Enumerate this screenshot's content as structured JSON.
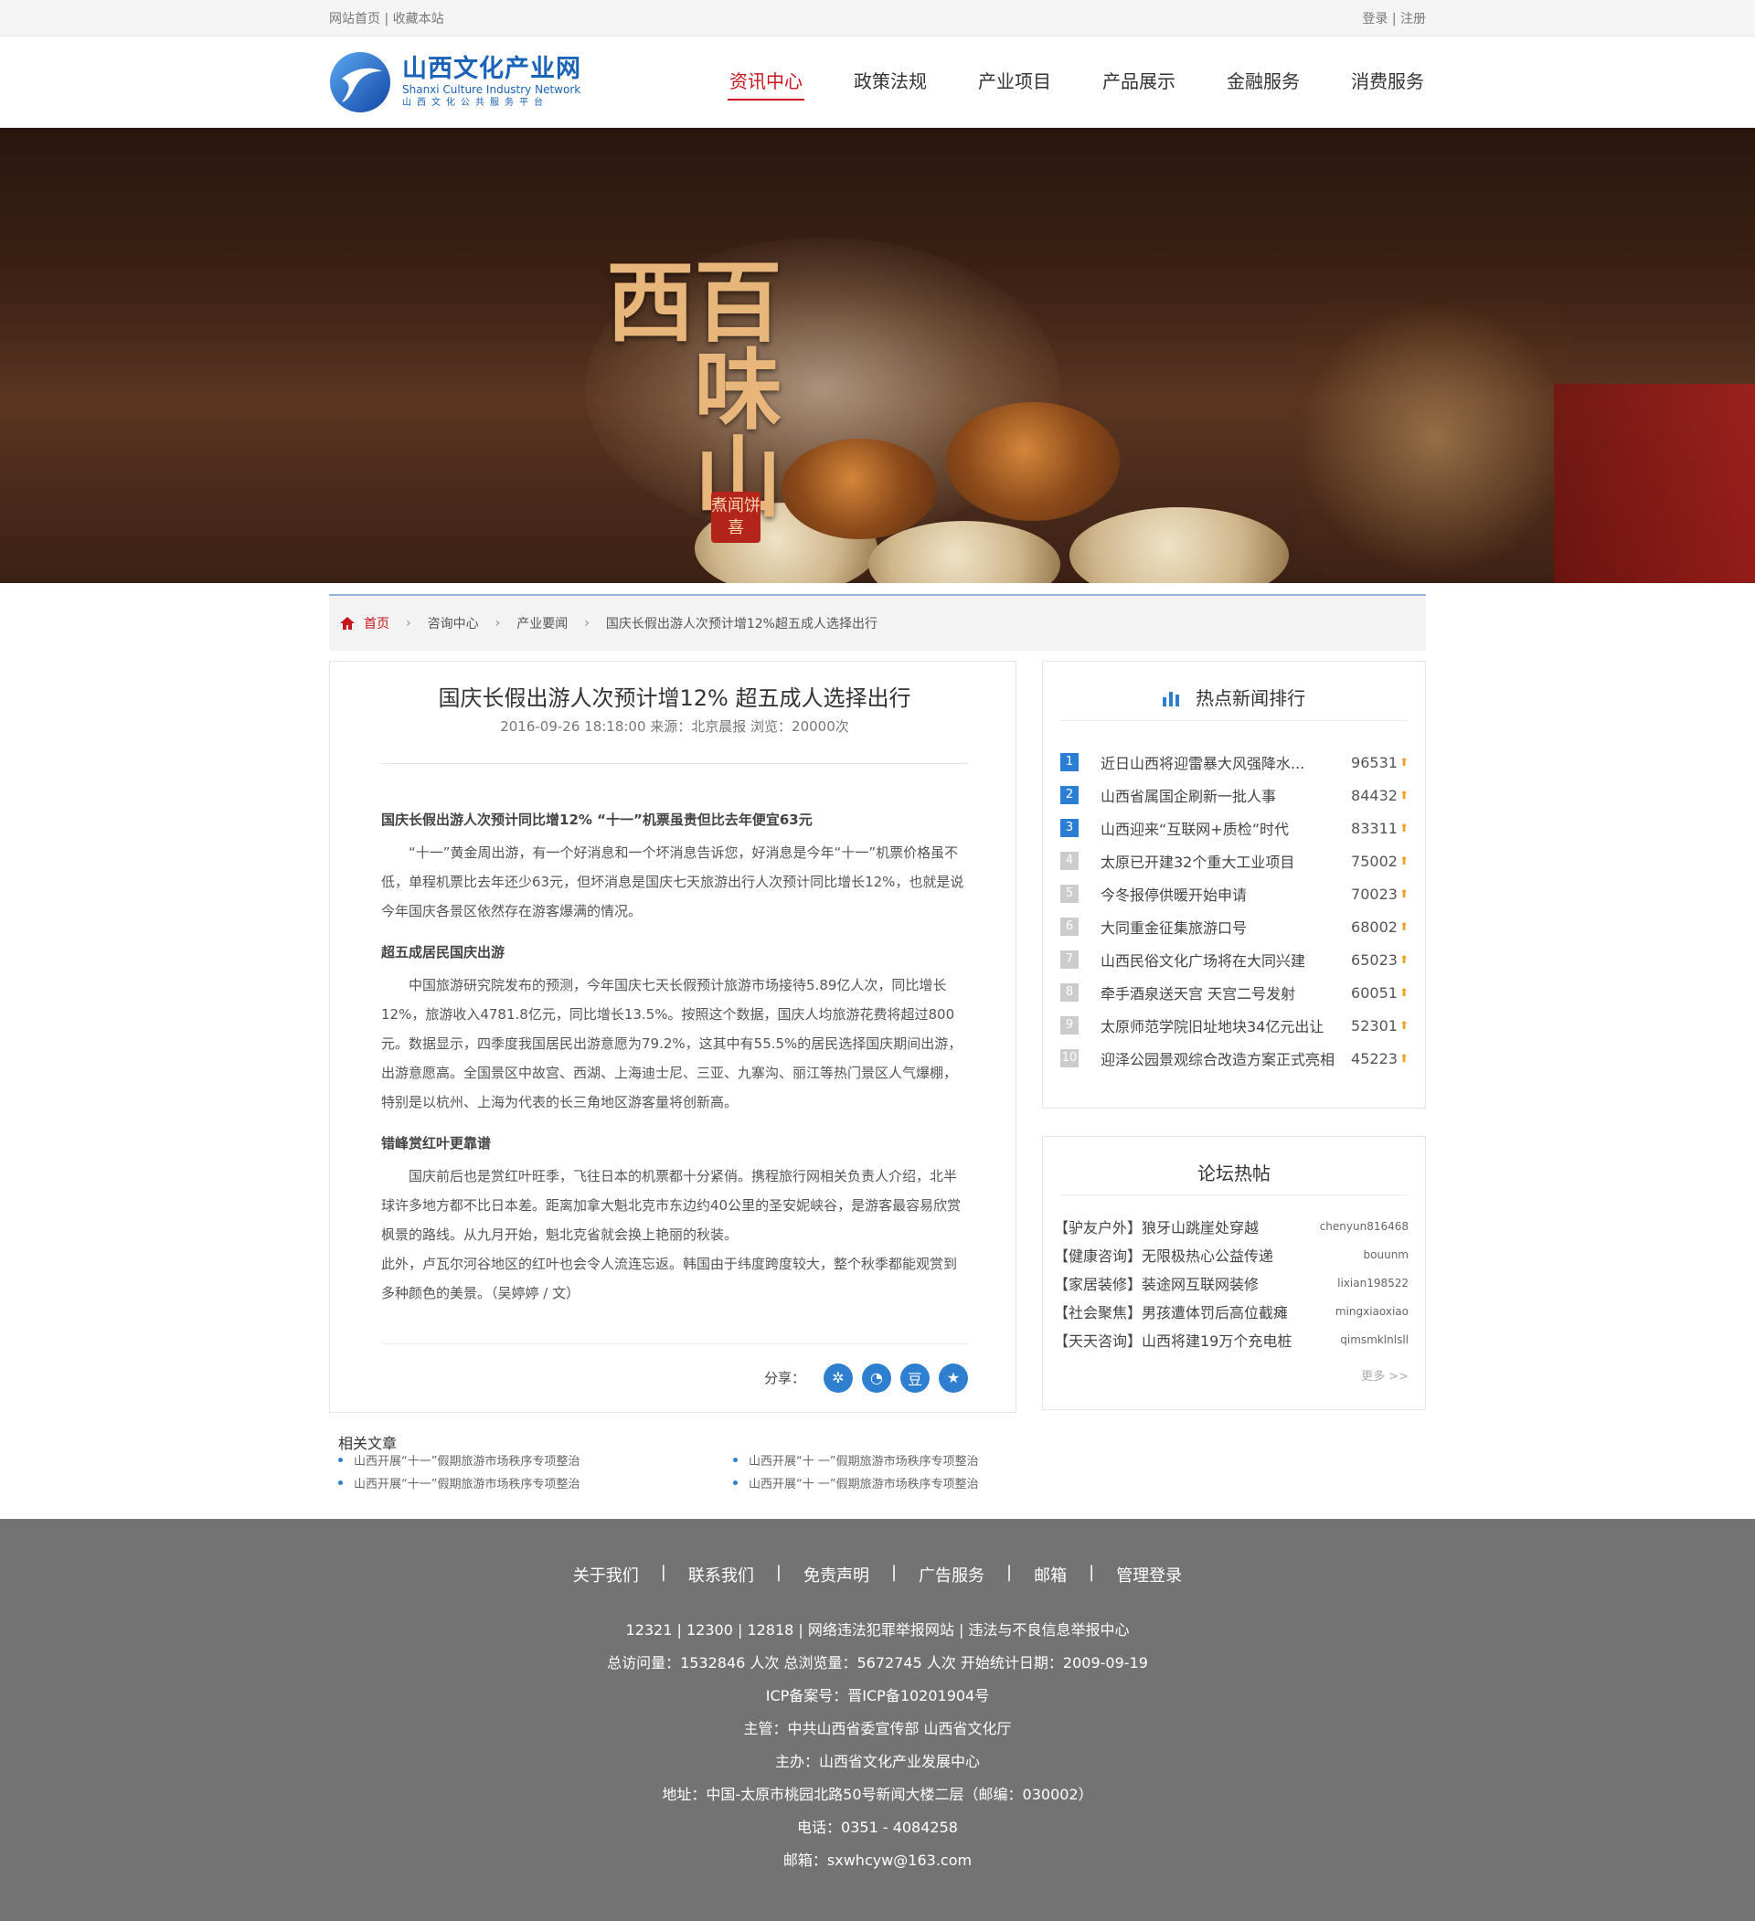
{
  "topbar": {
    "left": "网站首页 | 收藏本站",
    "right": "登录 | 注册"
  },
  "logo": {
    "cn": "山西文化产业网",
    "en": "Shanxi Culture Industry Network",
    "sub": "山西文化公共服务平台"
  },
  "nav": [
    "资讯中心",
    "政策法规",
    "产业项目",
    "产品展示",
    "金融服务",
    "消费服务"
  ],
  "banner": {
    "title": "百味山西",
    "seal": "煮闻饼喜"
  },
  "breadcrumb": [
    "首页",
    "咨询中心",
    "产业要闻",
    "国庆长假出游人次预计增12%超五成人选择出行"
  ],
  "article": {
    "title": "国庆长假出游人次预计增12% 超五成人选择出行",
    "meta": "2016-09-26 18:18:00 来源：北京晨报   浏览：20000次",
    "sections": [
      {
        "heading": "国庆长假出游人次预计同比增12%  “十一”机票虽贵但比去年便宜63元",
        "paras": [
          "“十一”黄金周出游，有一个好消息和一个坏消息告诉您，好消息是今年“十一”机票价格虽不低，单程机票比去年还少63元，但坏消息是国庆七天旅游出行人次预计同比增长12%，也就是说今年国庆各景区依然存在游客爆满的情况。"
        ]
      },
      {
        "heading": "超五成居民国庆出游",
        "paras": [
          "中国旅游研究院发布的预测，今年国庆七天长假预计旅游市场接待5.89亿人次，同比增长12%，旅游收入4781.8亿元，同比增长13.5%。按照这个数据，国庆人均旅游花费将超过800元。数据显示，四季度我国居民出游意愿为79.2%，这其中有55.5%的居民选择国庆期间出游，出游意愿高。全国景区中故宫、西湖、上海迪士尼、三亚、九寨沟、丽江等热门景区人气爆棚，特别是以杭州、上海为代表的长三角地区游客量将创新高。"
        ]
      },
      {
        "heading": "错峰赏红叶更靠谱",
        "paras": [
          "国庆前后也是赏红叶旺季，飞往日本的机票都十分紧俏。携程旅行网相关负责人介绍，北半球许多地方都不比日本差。距离加拿大魁北克市东边约40公里的圣安妮峡谷，是游客最容易欣赏枫景的路线。从九月开始，魁北克省就会换上艳丽的秋装。",
          "此外，卢瓦尔河谷地区的红叶也会令人流连忘返。韩国由于纬度跨度较大，整个秋季都能观赏到多种颜色的美景。（吴婷婷 / 文）"
        ]
      }
    ],
    "share_label": "分享：",
    "share_icons": [
      "weibo-icon",
      "wechat-icon",
      "douban-icon",
      "qzone-icon"
    ]
  },
  "hot": {
    "title": "热点新闻排行",
    "items": [
      {
        "rank": "1",
        "title": "近日山西将迎雷暴大风强降水...",
        "count": "96531"
      },
      {
        "rank": "2",
        "title": "山西省属国企刷新一批人事",
        "count": "84432"
      },
      {
        "rank": "3",
        "title": "山西迎来“互联网+质检”时代",
        "count": "83311"
      },
      {
        "rank": "4",
        "title": "太原已开建32个重大工业项目",
        "count": "75002"
      },
      {
        "rank": "5",
        "title": "今冬报停供暖开始申请",
        "count": "70023"
      },
      {
        "rank": "6",
        "title": "大同重金征集旅游口号",
        "count": "68002"
      },
      {
        "rank": "7",
        "title": "山西民俗文化广场将在大同兴建",
        "count": "65023"
      },
      {
        "rank": "8",
        "title": "牵手酒泉送天宫 天宫二号发射",
        "count": "60051"
      },
      {
        "rank": "9",
        "title": "太原师范学院旧址地块34亿元出让",
        "count": "52301"
      },
      {
        "rank": "10",
        "title": "迎泽公园景观综合改造方案正式亮相",
        "count": "45223"
      }
    ]
  },
  "forum": {
    "title": "论坛热帖",
    "items": [
      {
        "title": "【驴友户外】狼牙山跳崖处穿越",
        "user": "chenyun816468"
      },
      {
        "title": "【健康咨询】无限极热心公益传递",
        "user": "bouunm"
      },
      {
        "title": "【家居装修】装途网互联网装修",
        "user": "lixian198522"
      },
      {
        "title": "【社会聚焦】男孩遭体罚后高位截瘫",
        "user": "mingxiaoxiao"
      },
      {
        "title": "【天天咨询】山西将建19万个充电桩",
        "user": "qimsmklnlsll"
      }
    ],
    "more": "更多 >>"
  },
  "related": {
    "title": "相关文章",
    "items": [
      "山西开展“十一”假期旅游市场秩序专项整治",
      "山西开展“十 一”假期旅游市场秩序专项整治",
      "山西开展“十一”假期旅游市场秩序专项整治",
      "山西开展“十 一”假期旅游市场秩序专项整治"
    ]
  },
  "footer": {
    "links": [
      "关于我们",
      "联系我们",
      "免责声明",
      "广告服务",
      "邮箱",
      "管理登录"
    ],
    "lines": [
      "12321 | 12300 | 12818 | 网络违法犯罪举报网站 | 违法与不良信息举报中心",
      "总访问量：1532846 人次  总浏览量：5672745 人次  开始统计日期：2009-09-19",
      "ICP备案号：晋ICP备10201904号",
      "主管：中共山西省委宣传部 山西省文化厅",
      "主办：山西省文化产业发展中心",
      "地址：中国-太原市桃园北路50号新闻大楼二层（邮编：030002）",
      "电话：0351 - 4084258",
      "邮箱：sxwhcyw@163.com"
    ]
  },
  "colors": {
    "accent": "#c8161d",
    "blue": "#2a7fd4",
    "footer_bg": "#737373"
  }
}
